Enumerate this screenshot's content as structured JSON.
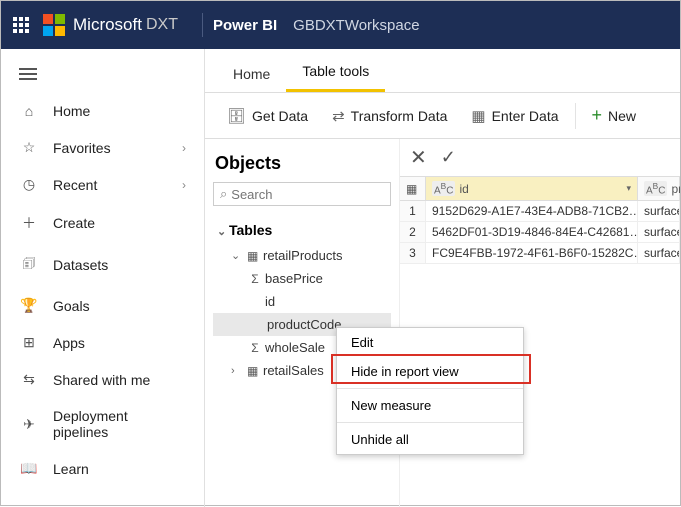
{
  "topbar": {
    "brand": "Microsoft",
    "dxt": "DXT",
    "product": "Power BI",
    "workspace": "GBDXTWorkspace"
  },
  "nav": {
    "items": [
      {
        "icon": "⌂",
        "label": "Home",
        "chev": false
      },
      {
        "icon": "☆",
        "label": "Favorites",
        "chev": true
      },
      {
        "icon": "◷",
        "label": "Recent",
        "chev": true
      },
      {
        "icon": "＋",
        "label": "Create",
        "chev": false
      },
      {
        "icon": "🗊",
        "label": "Datasets",
        "chev": false
      },
      {
        "icon": "🏆",
        "label": "Goals",
        "chev": false
      },
      {
        "icon": "⊞",
        "label": "Apps",
        "chev": false
      },
      {
        "icon": "⇆",
        "label": "Shared with me",
        "chev": false
      },
      {
        "icon": "✈",
        "label": "Deployment pipelines",
        "chev": false
      },
      {
        "icon": "📖",
        "label": "Learn",
        "chev": false
      }
    ]
  },
  "tabs": {
    "home": "Home",
    "tabletools": "Table tools"
  },
  "ribbon": {
    "getdata": "Get Data",
    "transform": "Transform Data",
    "enter": "Enter Data",
    "new": "New"
  },
  "objects": {
    "title": "Objects",
    "search_placeholder": "Search",
    "tables_hdr": "Tables",
    "tree": {
      "retailProducts": "retailProducts",
      "basePrice": "basePrice",
      "id": "id",
      "productCode": "productCode",
      "wholeSale": "wholeSale",
      "retailSales": "retailSales"
    }
  },
  "grid": {
    "col_id": "id",
    "col_pc": "prc",
    "rows": [
      {
        "n": "1",
        "id": "9152D629-A1E7-43E4-ADB8-71CB2…",
        "pc": "surface"
      },
      {
        "n": "2",
        "id": "5462DF01-3D19-4846-84E4-C42681…",
        "pc": "surface"
      },
      {
        "n": "3",
        "id": "FC9E4FBB-1972-4F61-B6F0-15282C…",
        "pc": "surface"
      }
    ]
  },
  "ctx": {
    "edit": "Edit",
    "hide": "Hide in report view",
    "newmeasure": "New measure",
    "unhide": "Unhide all"
  }
}
